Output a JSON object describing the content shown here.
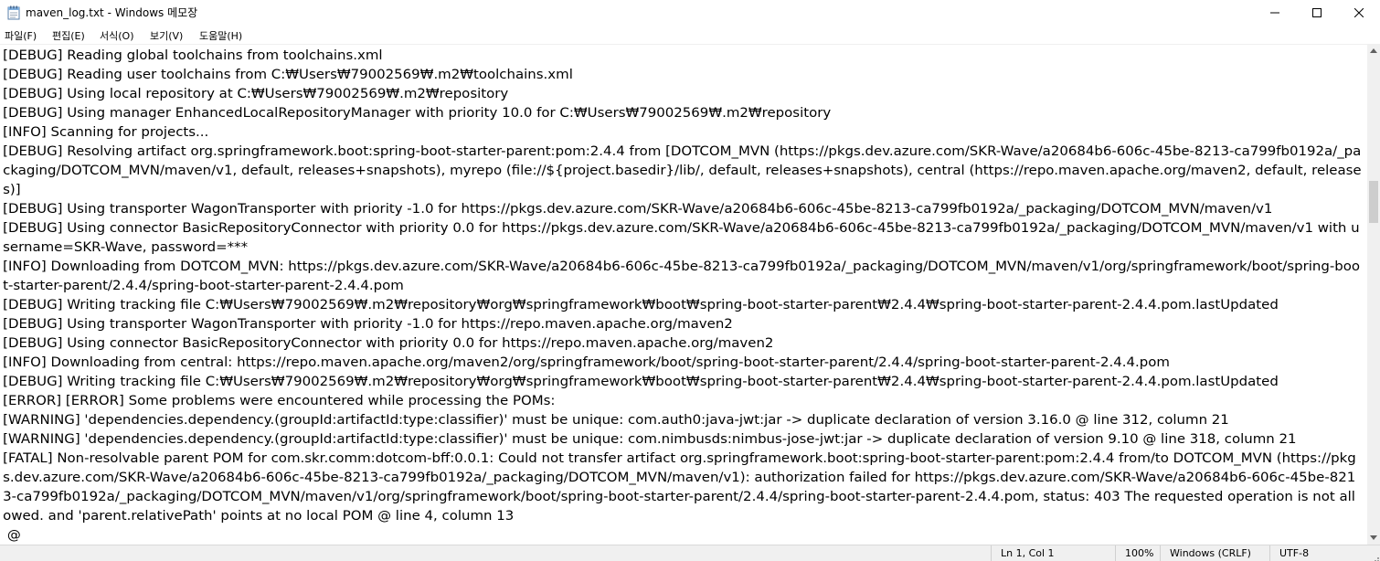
{
  "window": {
    "title": "maven_log.txt - Windows 메모장",
    "icon": "notepad-icon"
  },
  "menu": {
    "items": [
      "파일(F)",
      "편집(E)",
      "서식(O)",
      "보기(V)",
      "도움말(H)"
    ]
  },
  "log_lines": [
    "[DEBUG] Reading global toolchains from toolchains.xml",
    "[DEBUG] Reading user toolchains from C:₩Users₩79002569₩.m2₩toolchains.xml",
    "[DEBUG] Using local repository at C:₩Users₩79002569₩.m2₩repository",
    "[DEBUG] Using manager EnhancedLocalRepositoryManager with priority 10.0 for C:₩Users₩79002569₩.m2₩repository",
    "[INFO] Scanning for projects...",
    "[DEBUG] Resolving artifact org.springframework.boot:spring-boot-starter-parent:pom:2.4.4 from [DOTCOM_MVN (https://pkgs.dev.azure.com/SKR-Wave/a20684b6-606c-45be-8213-ca799fb0192a/_packaging/DOTCOM_MVN/maven/v1, default, releases+snapshots), myrepo (file://${project.basedir}/lib/, default, releases+snapshots), central (https://repo.maven.apache.org/maven2, default, releases)]",
    "[DEBUG] Using transporter WagonTransporter with priority -1.0 for https://pkgs.dev.azure.com/SKR-Wave/a20684b6-606c-45be-8213-ca799fb0192a/_packaging/DOTCOM_MVN/maven/v1",
    "[DEBUG] Using connector BasicRepositoryConnector with priority 0.0 for https://pkgs.dev.azure.com/SKR-Wave/a20684b6-606c-45be-8213-ca799fb0192a/_packaging/DOTCOM_MVN/maven/v1 with username=SKR-Wave, password=***",
    "[INFO] Downloading from DOTCOM_MVN: https://pkgs.dev.azure.com/SKR-Wave/a20684b6-606c-45be-8213-ca799fb0192a/_packaging/DOTCOM_MVN/maven/v1/org/springframework/boot/spring-boot-starter-parent/2.4.4/spring-boot-starter-parent-2.4.4.pom",
    "[DEBUG] Writing tracking file C:₩Users₩79002569₩.m2₩repository₩org₩springframework₩boot₩spring-boot-starter-parent₩2.4.4₩spring-boot-starter-parent-2.4.4.pom.lastUpdated",
    "[DEBUG] Using transporter WagonTransporter with priority -1.0 for https://repo.maven.apache.org/maven2",
    "[DEBUG] Using connector BasicRepositoryConnector with priority 0.0 for https://repo.maven.apache.org/maven2",
    "[INFO] Downloading from central: https://repo.maven.apache.org/maven2/org/springframework/boot/spring-boot-starter-parent/2.4.4/spring-boot-starter-parent-2.4.4.pom",
    "[DEBUG] Writing tracking file C:₩Users₩79002569₩.m2₩repository₩org₩springframework₩boot₩spring-boot-starter-parent₩2.4.4₩spring-boot-starter-parent-2.4.4.pom.lastUpdated",
    "[ERROR] [ERROR] Some problems were encountered while processing the POMs:",
    "[WARNING] 'dependencies.dependency.(groupId:artifactId:type:classifier)' must be unique: com.auth0:java-jwt:jar -> duplicate declaration of version 3.16.0 @ line 312, column 21",
    "[WARNING] 'dependencies.dependency.(groupId:artifactId:type:classifier)' must be unique: com.nimbusds:nimbus-jose-jwt:jar -> duplicate declaration of version 9.10 @ line 318, column 21",
    "[FATAL] Non-resolvable parent POM for com.skr.comm:dotcom-bff:0.0.1: Could not transfer artifact org.springframework.boot:spring-boot-starter-parent:pom:2.4.4 from/to DOTCOM_MVN (https://pkgs.dev.azure.com/SKR-Wave/a20684b6-606c-45be-8213-ca799fb0192a/_packaging/DOTCOM_MVN/maven/v1): authorization failed for https://pkgs.dev.azure.com/SKR-Wave/a20684b6-606c-45be-8213-ca799fb0192a/_packaging/DOTCOM_MVN/maven/v1/org/springframework/boot/spring-boot-starter-parent/2.4.4/spring-boot-starter-parent-2.4.4.pom, status: 403 The requested operation is not allowed. and 'parent.relativePath' points at no local POM @ line 4, column 13",
    " @"
  ],
  "status": {
    "position": "Ln 1, Col 1",
    "zoom": "100%",
    "line_ending": "Windows (CRLF)",
    "encoding": "UTF-8"
  },
  "colors": {
    "status_bg": "#f0f0f0",
    "scroll_thumb": "#cdcdcd"
  }
}
